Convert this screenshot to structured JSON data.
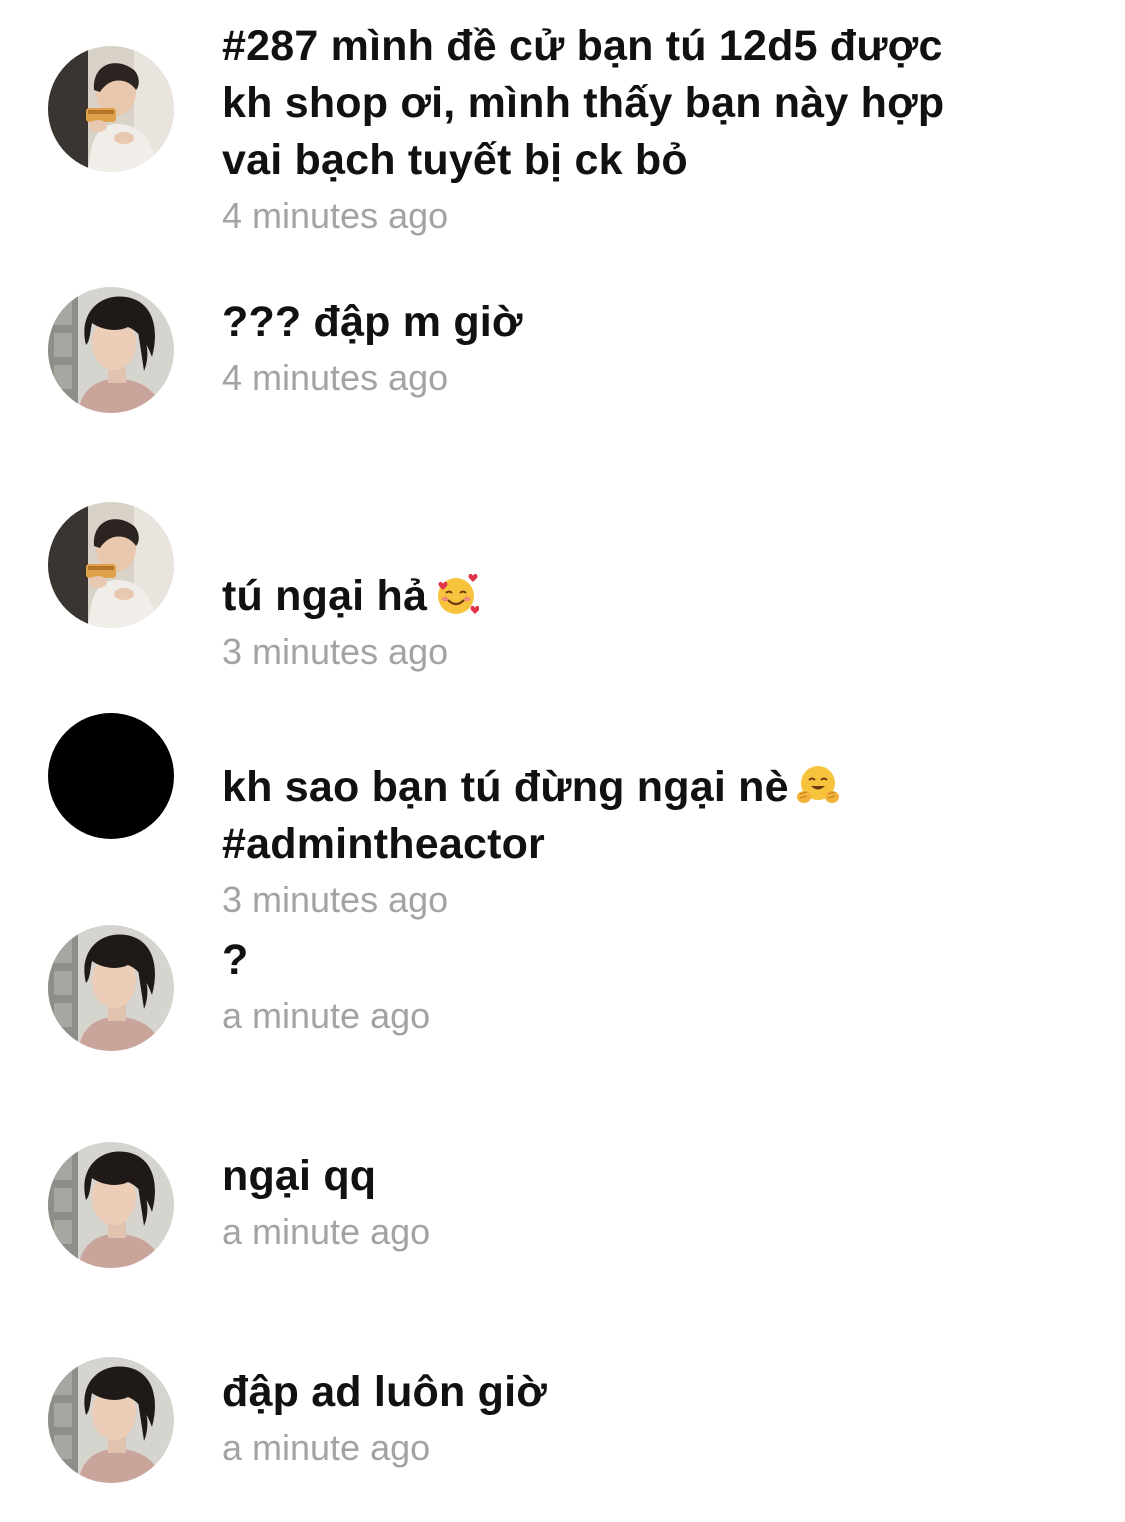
{
  "messages": [
    {
      "text": "#287 mình đề cử bạn tú 12d5 được\nkh shop ơi, mình thấy bạn này hợp\nvai bạch tuyết bị ck bỏ",
      "emoji": "",
      "time": "4 minutes ago",
      "avatar": "person-eating"
    },
    {
      "text": "??? đập m giờ",
      "emoji": "",
      "time": "4 minutes ago",
      "avatar": "person-portrait"
    },
    {
      "text": "tú ngại hả",
      "emoji": "smiling-face-with-hearts",
      "time": "3 minutes ago",
      "avatar": "person-eating"
    },
    {
      "text": "kh sao bạn tú đừng ngại nè",
      "emoji": "hugging-face",
      "tag": "#admintheactor",
      "time": "3 minutes ago",
      "avatar": "blank"
    },
    {
      "text": "?",
      "emoji": "",
      "time": "a minute ago",
      "avatar": "person-portrait"
    },
    {
      "text": "ngại qq",
      "emoji": "",
      "time": "a minute ago",
      "avatar": "person-portrait"
    },
    {
      "text": "đập ad luôn giờ",
      "emoji": "",
      "time": "a minute ago",
      "avatar": "person-portrait"
    }
  ],
  "colors": {
    "text": "#111111",
    "timestamp": "#a3a3a3",
    "background": "#ffffff",
    "blank_avatar": "#000000"
  }
}
